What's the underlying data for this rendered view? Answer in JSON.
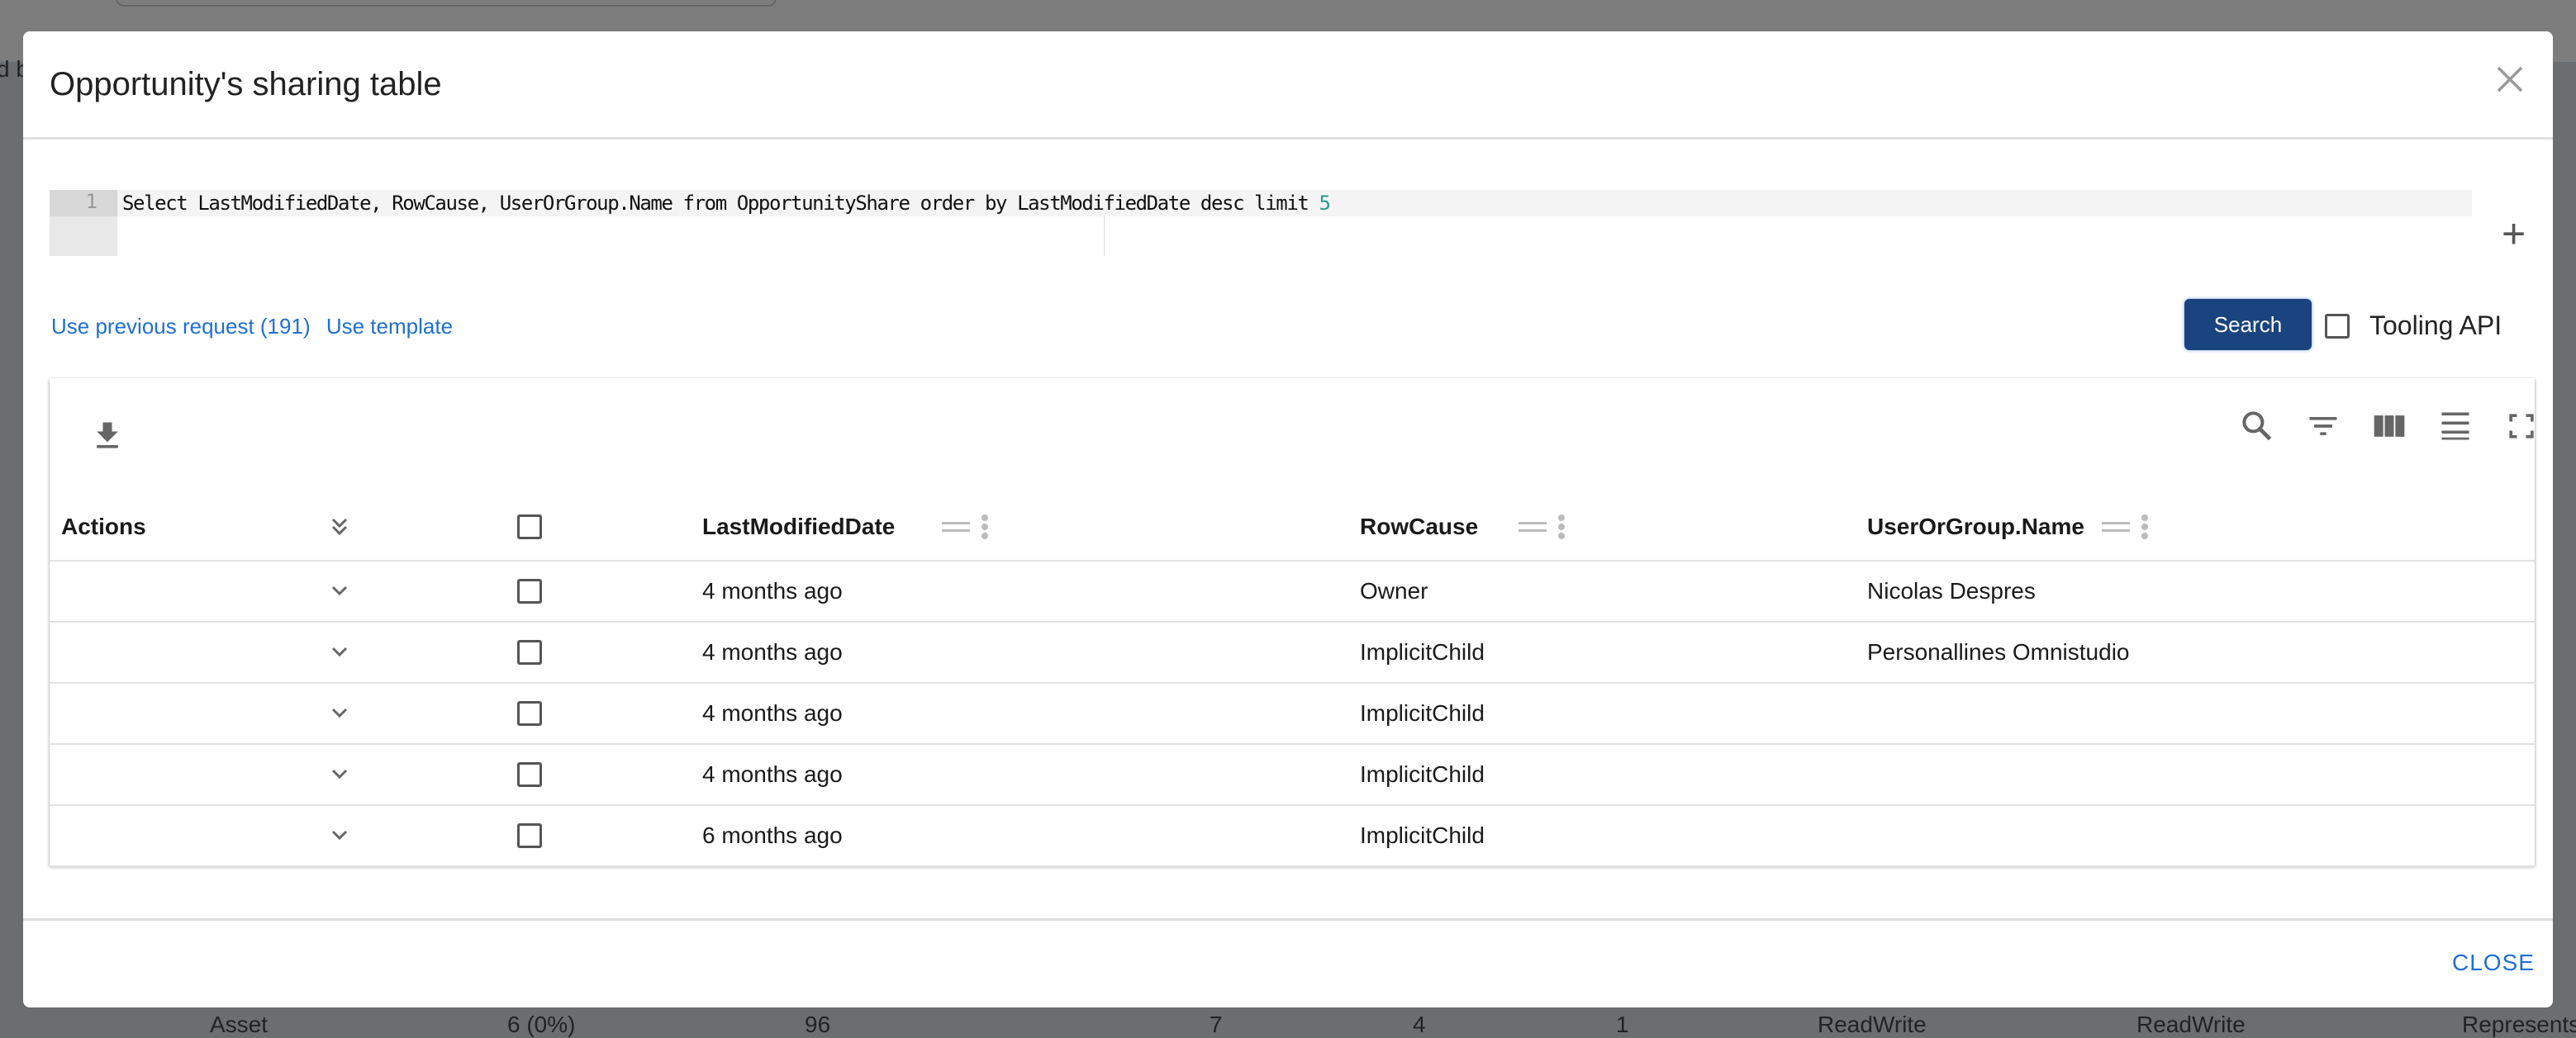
{
  "background": {
    "partial_text": "d b",
    "row": [
      "Asset",
      "6 (0%)",
      "96",
      "7",
      "4",
      "1",
      "ReadWrite",
      "ReadWrite",
      "Represents"
    ]
  },
  "modal": {
    "title": "Opportunity's sharing table",
    "editor": {
      "line_number": "1",
      "query": "Select LastModifiedDate, RowCause, UserOrGroup.Name from OpportunityShare order by LastModifiedDate desc limit ",
      "query_limit": "5"
    },
    "links": {
      "previous": "Use previous request (191)",
      "template": "Use template"
    },
    "search_label": "Search",
    "tooling_api_label": "Tooling API",
    "tooling_api_checked": false,
    "table": {
      "columns": [
        "Actions",
        "LastModifiedDate",
        "RowCause",
        "UserOrGroup.Name"
      ],
      "rows": [
        {
          "date": "4 months ago",
          "cause": "Owner",
          "name": "Nicolas Despres"
        },
        {
          "date": "4 months ago",
          "cause": "ImplicitChild",
          "name": "Personallines Omnistudio"
        },
        {
          "date": "4 months ago",
          "cause": "ImplicitChild",
          "name": ""
        },
        {
          "date": "4 months ago",
          "cause": "ImplicitChild",
          "name": ""
        },
        {
          "date": "6 months ago",
          "cause": "ImplicitChild",
          "name": ""
        }
      ]
    },
    "close_label": "CLOSE",
    "colors": {
      "primary": "#1a4480",
      "link": "#1f6fd1",
      "query_number": "#2a9d8f"
    }
  }
}
